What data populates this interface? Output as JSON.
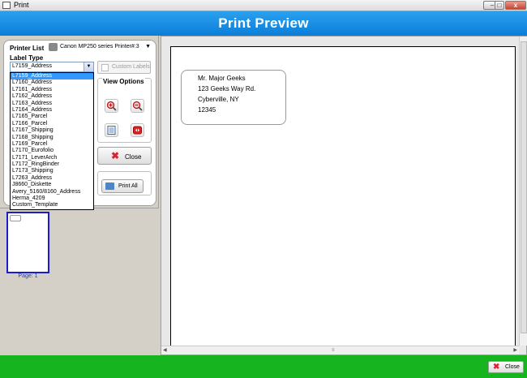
{
  "window": {
    "title": "Print",
    "min_label": "–",
    "max_label": "□",
    "close_label": "x"
  },
  "header": {
    "title": "Print Preview"
  },
  "settings": {
    "printer_list_label": "Printer List",
    "printer_value": "Canon MP250 series Printer#:3",
    "label_type_label": "Label Type",
    "label_type_value": "L7159_Address",
    "label_options": [
      "L7159_Address",
      "L7160_Address",
      "L7161_Address",
      "L7162_Address",
      "L7163_Address",
      "L7164_Address",
      "L7165_Parcel",
      "L7166_Parcel",
      "L7167_Shipping",
      "L7168_Shipping",
      "L7169_Parcel",
      "L7170_Eurofolio",
      "L7171_LeverArch",
      "L7172_RingBinder",
      "L7173_Shipping",
      "L7263_Address",
      "J8660_Diskette",
      "Avery_5160/8160_Address",
      "Herma_4209",
      "Custom_Template"
    ],
    "custom_labels_label": "Custom Labels",
    "view_options_label": "View Options",
    "close_label": "Close",
    "print_all_label": "Print All"
  },
  "thumbnails": {
    "page_label": "Page: 1"
  },
  "preview": {
    "address_lines": [
      "Mr. Major Geeks",
      "123 Geeks Way Rd.",
      "Cyberville, NY",
      "12345"
    ]
  },
  "footer": {
    "close_label": "Close"
  },
  "colors": {
    "header": "#0b7ed8",
    "footer": "#16b41e",
    "selection": "#3399ff"
  }
}
